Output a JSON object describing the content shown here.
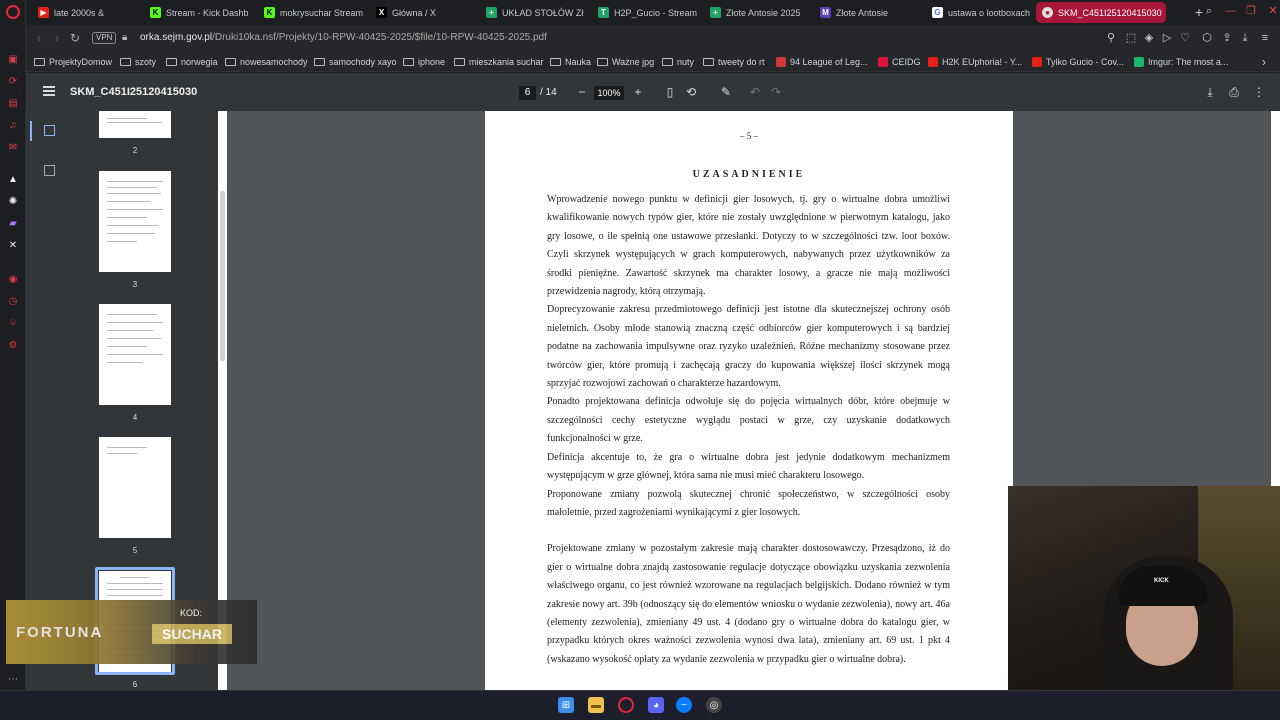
{
  "browser": {
    "tabs": [
      {
        "label": "late 2000s &",
        "favicon_color": "#e62117",
        "prefix": "·"
      },
      {
        "label": "Stream - Kick Dashb",
        "favicon_color": "#53fc18",
        "icon": "K"
      },
      {
        "label": "mokrysuchar Stream",
        "favicon_color": "#53fc18",
        "icon": "K"
      },
      {
        "label": "Główna / X",
        "favicon_color": "#000000",
        "icon": "X"
      },
      {
        "label": "UKŁAD STOŁÓW Zł",
        "favicon_color": "#1fa463",
        "icon": "+"
      },
      {
        "label": "H2P_Gucio - Stream",
        "favicon_color": "#1fa463",
        "icon": "T"
      },
      {
        "label": "Złote Antosie 2025",
        "favicon_color": "#1fa463",
        "icon": "+"
      },
      {
        "label": "Złote Antosie",
        "favicon_color": "#5b3fb5",
        "icon": "M"
      },
      {
        "label": "ustawa o lootboxach",
        "favicon_color": "#ffffff",
        "icon": "G"
      },
      {
        "label": "SKM_C451I25120415030",
        "favicon_color": "#dddddd",
        "icon": "●",
        "active": true
      }
    ],
    "url_domain": "orka.sejm.gov.pl",
    "url_path": "/Druki10ka.nsf/Projekty/10-RPW-40425-2025/$file/10-RPW-40425-2025.pdf",
    "vpn_label": "VPN",
    "bookmarks": [
      {
        "label": "ProjektyDomow",
        "type": "folder"
      },
      {
        "label": "szoty",
        "type": "folder"
      },
      {
        "label": "norwegia",
        "type": "folder"
      },
      {
        "label": "nowesamochody",
        "type": "folder"
      },
      {
        "label": "samochody xayo",
        "type": "folder"
      },
      {
        "label": "iphone",
        "type": "folder"
      },
      {
        "label": "mieszkania suchar",
        "type": "folder"
      },
      {
        "label": "Nauka",
        "type": "folder"
      },
      {
        "label": "Ważne jpg",
        "type": "folder"
      },
      {
        "label": "nuty",
        "type": "folder"
      },
      {
        "label": "tweety do rt",
        "type": "folder"
      },
      {
        "label": "94 League of Leg...",
        "type": "site",
        "color": "#d13639"
      },
      {
        "label": "CEIDG",
        "type": "site",
        "color": "#dc143c"
      },
      {
        "label": "H2K EUphoria! - Y...",
        "type": "site",
        "color": "#e62117"
      },
      {
        "label": "Tylko Gucio - Cov...",
        "type": "site",
        "color": "#e62117"
      },
      {
        "label": "Imgur: The most a...",
        "type": "site",
        "color": "#1bb76e"
      }
    ]
  },
  "pdf": {
    "title": "SKM_C451I25120415030",
    "current_page": "6",
    "total_pages": "/ 14",
    "zoom": "100%",
    "thumbnail_labels": [
      "2",
      "3",
      "4",
      "5",
      "6"
    ],
    "page_number_label": "– 5 –",
    "heading": "UZASADNIENIE",
    "paragraphs": [
      "Wprowadzenie nowego punktu w definicji gier losowych, tj. gry o wirtualne dobra umożliwi kwalifikowanie nowych typów gier, które nie zostały uwzględnione w pierwotnym katalogu, jako gry losowe, o ile spełnią one ustawowe przesłanki. Dotyczy to w szczególności tzw. loot boxów. Czyli skrzynek występujących w grach komputerowych, nabywanych przez użytkowników za środki pieniężne. Zawartość skrzynek ma charakter losowy, a gracze nie mają możliwości przewidzenia nagrody, którą otrzymają.",
      "Doprecyzowanie zakresu przedmiotowego definicji jest istotne dla skutecznejszej ochrony osób nieletnich. Osoby młode stanowią znaczną część odbiorców gier komputerowych i są bardziej podatne na zachowania impulsywne oraz ryzyko uzależnień. Różne mechanizmy stosowane przez twórców gier, które promują i zachęcają graczy do kupowania większej ilości skrzynek mogą sprzyjać rozwojowi zachowań o charakterze hazardowym.",
      "Ponadto projektowana definicja odwołuje się do pojęcia wirtualnych dóbr, które obejmuje w szczególności cechy estetyczne wyglądu postaci w grze, czy uzyskanie dodatkowych funkcjonalności w grze.",
      "Definicja akcentuje to, że gra o wirtualne dobra jest jedynie dodatkowym mechanizmem występującym w grze głównej, która sama nie musi mieć charakteru losowego.",
      "Proponowane zmiany pozwolą skutecznej chronić społeczeństwo, w szczególności osoby małoletnie, przed zagrożeniami wynikającymi z gier losowych.",
      "Projektowane zmiany w pozostałym zakresie mają charakter dostosowawczy. Przesądzono, iż do gier o wirtualne dobra znajdą zastosowanie regulacje dotyczące obowiązku uzyskania zezwolenia właściwego organu, co jest również wzorowane na regulacjach belgijskich. Dodano również w tym zakresie nowy art. 39b (odnoszący się do elementów wniosku o wydanie zezwolenia), nowy art. 46a (elementy zezwolenia), zmieniany 49 ust. 4 (dodano gry o wirtualne dobra do katalogu gier, w przypadku których okres ważności zezwolenia wynosi dwa lata), zmieniany art. 69 ust. 1 pkt 4 (wskazano wysokość opłaty za wydanie zezwolenia w przypadku gier o wirtualne dobra)."
    ]
  },
  "overlay": {
    "sponsor_logo": "FORTUNA",
    "code_label": "KOD:",
    "code_value": "SUCHAR",
    "cap_text": "KICK"
  },
  "colors": {
    "active_tab": "#a8173a",
    "opera_red": "#e6283b",
    "pdf_toolbar": "#323639",
    "pdf_viewer_bg": "#525659"
  }
}
